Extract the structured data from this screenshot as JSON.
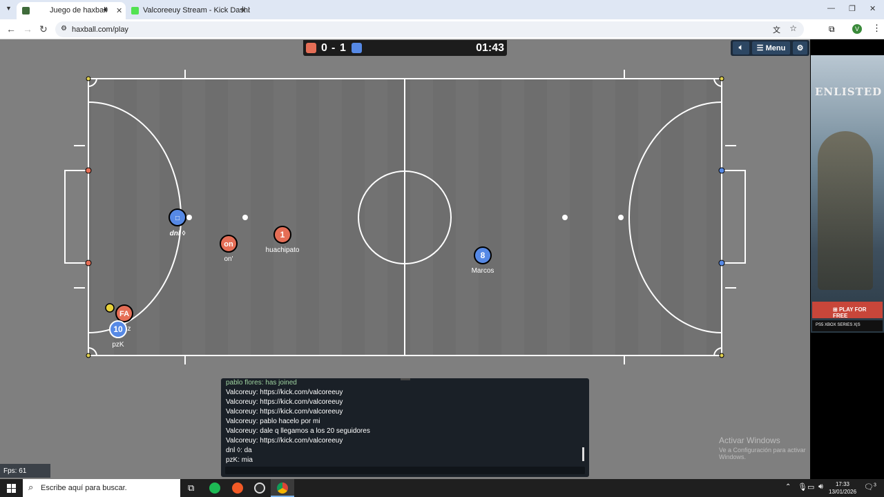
{
  "browser": {
    "tabs": [
      {
        "title": "Juego de haxball",
        "active": true,
        "close": "✕",
        "favicon_color": "#3f6b3a"
      },
      {
        "title": "Valcoreeuy Stream - Kick Dashb",
        "active": false,
        "close": "✕",
        "favicon_color": "#52e252"
      }
    ],
    "new_tab": "+",
    "url": "haxball.com/play",
    "profile_initial": "V",
    "window_controls": [
      "—",
      "❐",
      "✕"
    ]
  },
  "game": {
    "score_left": "0",
    "score_sep": "-",
    "score_right": "1",
    "time": "01:43",
    "red_color": "#e56e56",
    "blue_color": "#5689e5",
    "menu_label": "Menu",
    "players": [
      {
        "avatar": "□",
        "name": "dnl ◊",
        "team": "blue"
      },
      {
        "avatar": "on",
        "name": "on'",
        "team": "red"
      },
      {
        "avatar": "1",
        "name": "huachipato",
        "team": "red"
      },
      {
        "avatar": "8",
        "name": "Marcos",
        "team": "blue"
      },
      {
        "avatar": "FA",
        "name": "z",
        "team": "red"
      },
      {
        "avatar": "10",
        "name": "pzK",
        "team": "blue"
      }
    ],
    "fps": "Fps: 61"
  },
  "chat": {
    "messages": [
      "pablo flores: has joined",
      "Valcoreuy: https://kick.com/valcoreeuy",
      "Valcoreuy: https://kick.com/valcoreeuy",
      "Valcoreuy: https://kick.com/valcoreeuy",
      "Valcoreuy: pablo hacelo por mi",
      "Valcoreuy: dale q llegamos a los 20 seguidores",
      "Valcoreuy: https://kick.com/valcoreeuy",
      "dnl ◊: da",
      "pzK: mia"
    ]
  },
  "watermark": {
    "title": "Activar Windows",
    "subtitle": "Ve a Configuración para activar Windows."
  },
  "ad": {
    "logo": "ENLISTED",
    "cta": "PLAY FOR FREE",
    "platforms": "PS5  XBOX SERIES X|S"
  },
  "taskbar": {
    "search_placeholder": "Escribe aquí para buscar.",
    "time": "17:33",
    "date": "13/01/2026",
    "notifications": "3"
  }
}
